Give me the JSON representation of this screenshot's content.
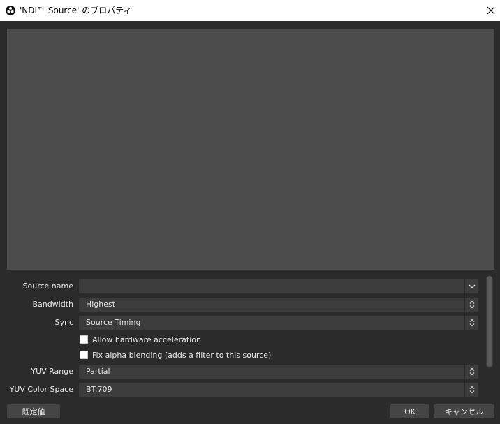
{
  "window": {
    "title": "'NDI™ Source' のプロパティ",
    "app_icon": "obs-icon",
    "close_icon": "close-icon"
  },
  "form": {
    "source_name": {
      "label": "Source name",
      "value": ""
    },
    "bandwidth": {
      "label": "Bandwidth",
      "value": "Highest"
    },
    "sync": {
      "label": "Sync",
      "value": "Source Timing"
    },
    "allow_hw_accel": {
      "label": "Allow hardware acceleration",
      "checked": false
    },
    "fix_alpha": {
      "label": "Fix alpha blending (adds a filter to this source)",
      "checked": false
    },
    "yuv_range": {
      "label": "YUV Range",
      "value": "Partial"
    },
    "yuv_color_space": {
      "label": "YUV Color Space",
      "value": "BT.709"
    }
  },
  "buttons": {
    "defaults": "既定値",
    "ok": "OK",
    "cancel": "キャンセル"
  },
  "colors": {
    "background": "#2b2b2b",
    "preview": "#4c4c4c",
    "field": "#3c3c3c",
    "button": "#454545"
  }
}
